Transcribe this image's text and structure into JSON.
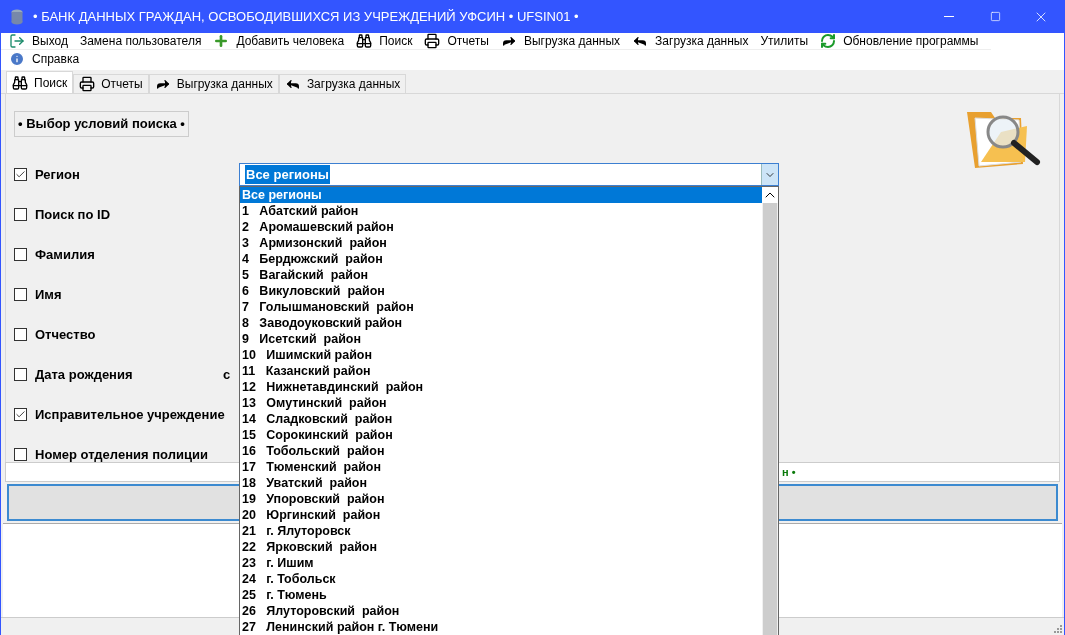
{
  "window": {
    "title": "• БАНК ДАННЫХ ГРАЖДАН, ОСВОБОДИВШИХСЯ ИЗ УЧРЕЖДЕНИЙ УФСИН • UFSIN01 •"
  },
  "menu_rows": [
    [
      {
        "label": "Выход"
      },
      {
        "label": "Замена пользователя"
      },
      {
        "label": "Добавить человека"
      },
      {
        "label": "Поиск"
      },
      {
        "label": "Отчеты"
      },
      {
        "label": "Выгрузка данных"
      },
      {
        "label": "Загрузка данных"
      },
      {
        "label": "Утилиты"
      },
      {
        "label": "Обновление программы"
      }
    ],
    [
      {
        "label": "Справка"
      }
    ]
  ],
  "tabs": [
    {
      "label": "Поиск",
      "selected": true
    },
    {
      "label": "Отчеты",
      "selected": false
    },
    {
      "label": "Выгрузка данных",
      "selected": false
    },
    {
      "label": "Загрузка данных",
      "selected": false
    }
  ],
  "search_panel": {
    "group_title": "• Выбор условий поиска •",
    "criteria": [
      {
        "label": "Регион",
        "checked": true
      },
      {
        "label": "Поиск по ID",
        "checked": false
      },
      {
        "label": "Фамилия",
        "checked": false
      },
      {
        "label": "Имя",
        "checked": false
      },
      {
        "label": "Отчество",
        "checked": false
      },
      {
        "label": "Дата рождения",
        "checked": false
      },
      {
        "label": "Исправительное учреждение",
        "checked": true
      },
      {
        "label": "Номер отделения полиции",
        "checked": false
      }
    ],
    "date_from_label": "с",
    "region_combo": {
      "value": "Все регионы",
      "expanded": true,
      "options": [
        {
          "text": "Все регионы",
          "selected": true
        },
        {
          "text": "1   Абатский район",
          "selected": false
        },
        {
          "text": "2   Аромашевский район",
          "selected": false
        },
        {
          "text": "3   Армизонский  район",
          "selected": false
        },
        {
          "text": "4   Бердюжский  район",
          "selected": false
        },
        {
          "text": "5   Вагайский  район",
          "selected": false
        },
        {
          "text": "6   Викуловский  район",
          "selected": false
        },
        {
          "text": "7   Голышмановский  район",
          "selected": false
        },
        {
          "text": "8   Заводоуковский район",
          "selected": false
        },
        {
          "text": "9   Исетский  район",
          "selected": false
        },
        {
          "text": "10   Ишимский район",
          "selected": false
        },
        {
          "text": "11   Казанский район",
          "selected": false
        },
        {
          "text": "12   Нижнетавдинский  район",
          "selected": false
        },
        {
          "text": "13   Омутинский  район",
          "selected": false
        },
        {
          "text": "14   Сладковский  район",
          "selected": false
        },
        {
          "text": "15   Сорокинский  район",
          "selected": false
        },
        {
          "text": "16   Тобольский  район",
          "selected": false
        },
        {
          "text": "17   Тюменский  район",
          "selected": false
        },
        {
          "text": "18   Уватский  район",
          "selected": false
        },
        {
          "text": "19   Упоровский  район",
          "selected": false
        },
        {
          "text": "20   Юргинский  район",
          "selected": false
        },
        {
          "text": "21   г. Ялуторовск",
          "selected": false
        },
        {
          "text": "22   Ярковский  район",
          "selected": false
        },
        {
          "text": "23   г. Ишим",
          "selected": false
        },
        {
          "text": "24   г. Тобольск",
          "selected": false
        },
        {
          "text": "25   г. Тюмень",
          "selected": false
        },
        {
          "text": "26   Ялуторовский  район",
          "selected": false
        },
        {
          "text": "27   Ленинский район г. Тюмени",
          "selected": false
        }
      ]
    }
  },
  "hint_strip": {
    "text": "н •"
  }
}
